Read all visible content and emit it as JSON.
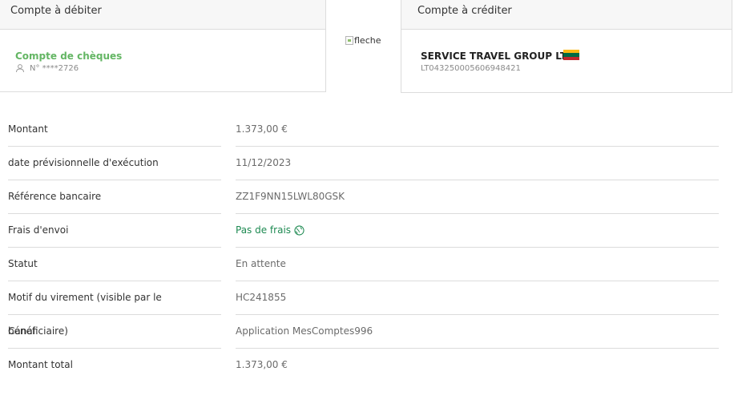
{
  "debit": {
    "header": "Compte à débiter",
    "account_name": "Compte de chèques",
    "account_number": "N° ****2726"
  },
  "arrow": {
    "alt": "fleche"
  },
  "credit": {
    "header": "Compte à créditer",
    "beneficiary_name": "SERVICE TRAVEL GROUP LTD",
    "iban": "LT043250005606948421",
    "flag_colors": [
      "#fdb913",
      "#006a44",
      "#c1272d"
    ]
  },
  "details": [
    {
      "label": "Montant",
      "value": "1.373,00 €"
    },
    {
      "label": "date prévisionnelle d'exécution",
      "value": "11/12/2023"
    },
    {
      "label": "Référence bancaire",
      "value": "ZZ1F9NN15LWL80GSK"
    },
    {
      "label": "Frais d'envoi",
      "value": "Pas de frais"
    },
    {
      "label": "Statut",
      "value": "En attente"
    },
    {
      "label": "Motif du virement (visible par le bénéficiaire)",
      "value": "HC241855"
    },
    {
      "label": "Canal",
      "value": "Application MesComptes996"
    },
    {
      "label": "Montant total",
      "value": "1.373,00 €"
    }
  ],
  "colors": {
    "accent_green": "#64b664",
    "fees_green": "#1e8a52"
  }
}
